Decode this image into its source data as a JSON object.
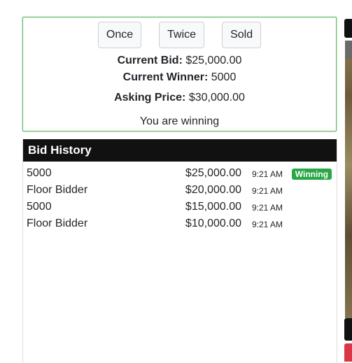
{
  "controls": {
    "once_label": "Once",
    "twice_label": "Twice",
    "sold_label": "Sold"
  },
  "status": {
    "current_bid_label": "Current Bid:",
    "current_bid_value": "$25,000.00",
    "current_winner_label": "Current Winner:",
    "current_winner_value": "5000",
    "asking_price_label": "Asking Price:",
    "asking_price_value": "$30,000.00",
    "message": "You are winning"
  },
  "history": {
    "title": "Bid History",
    "winning_label": "Winning",
    "rows": [
      {
        "bidder": "5000",
        "amount": "$25,000.00",
        "time": "9:21 AM"
      },
      {
        "bidder": "Floor Bidder",
        "amount": "$20,000.00",
        "time": "9:21 AM"
      },
      {
        "bidder": "5000",
        "amount": "$15,000.00",
        "time": "9:21 AM"
      },
      {
        "bidder": "Floor Bidder",
        "amount": "$10,000.00",
        "time": "9:21 AM"
      }
    ]
  },
  "colors": {
    "winning_badge": "#28a745",
    "header_bg": "#111111",
    "card_border": "#5cb85c"
  }
}
